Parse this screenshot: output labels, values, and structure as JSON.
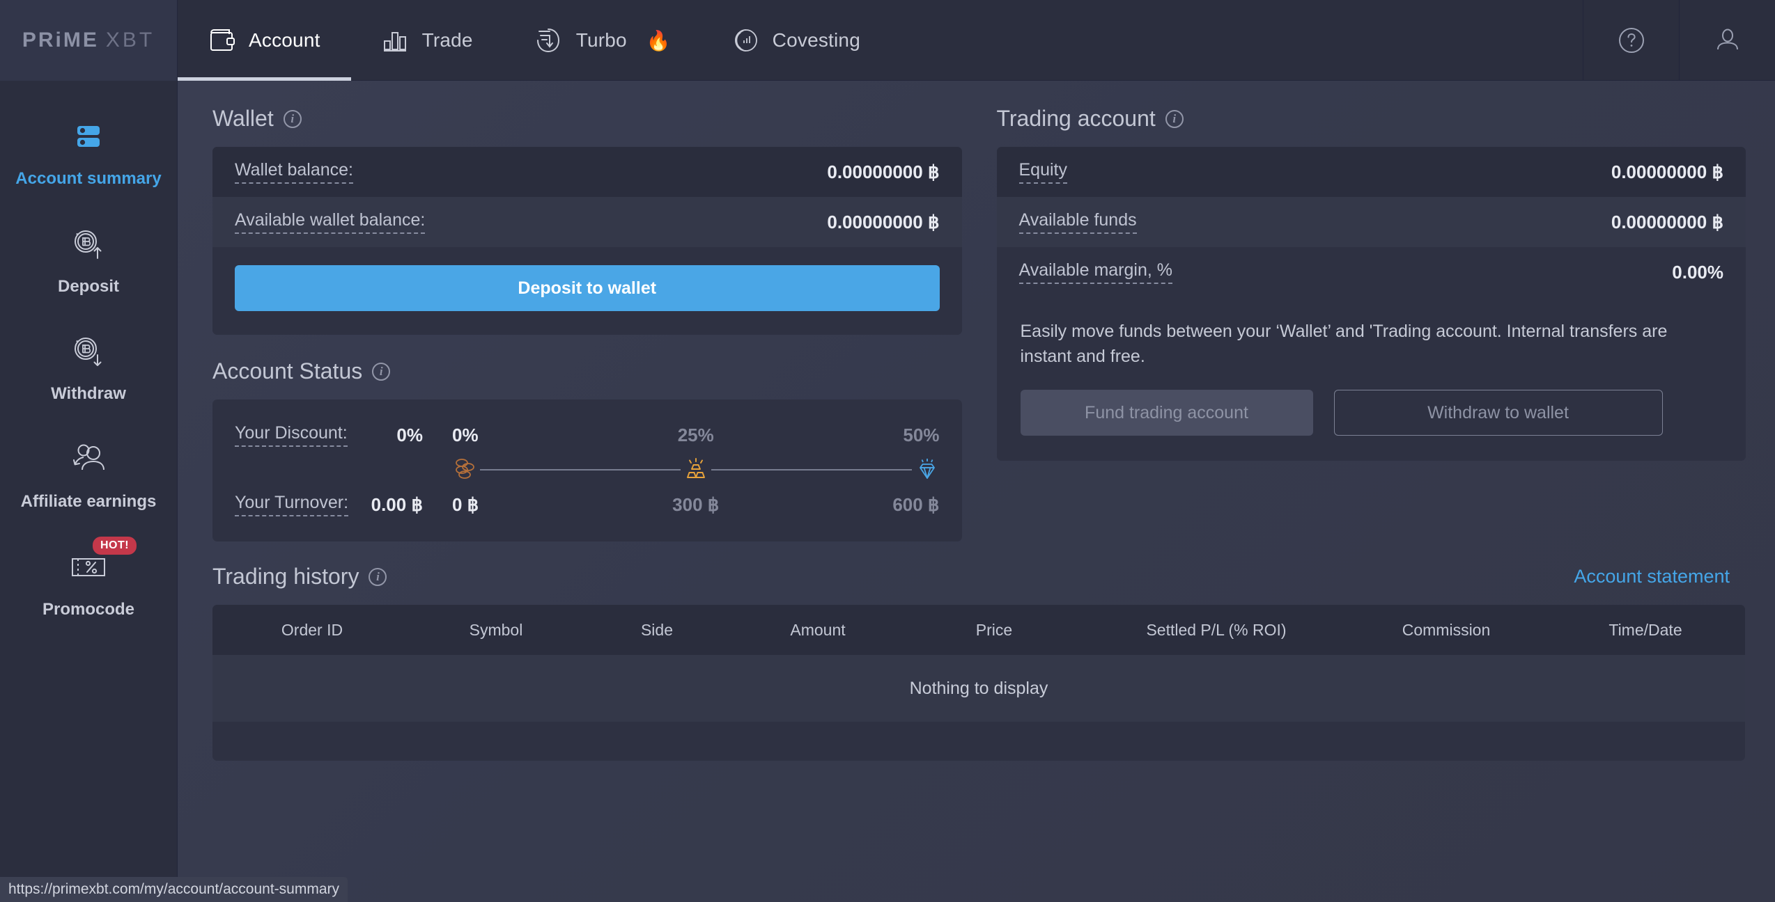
{
  "brand": {
    "prime": "PRiME",
    "xbt": "XBT"
  },
  "nav": {
    "tabs": [
      {
        "label": "Account",
        "icon": "wallet-icon",
        "active": true
      },
      {
        "label": "Trade",
        "icon": "bar-chart-icon",
        "active": false
      },
      {
        "label": "Turbo",
        "icon": "turbo-arrows-icon",
        "emoji": "🔥",
        "active": false
      },
      {
        "label": "Covesting",
        "icon": "covesting-rings-icon",
        "active": false
      }
    ],
    "help_icon": "question-mark-circle-icon",
    "profile_icon": "user-avatar-icon"
  },
  "sidebar": {
    "items": [
      {
        "label": "Account summary",
        "icon": "account-summary-icon",
        "active": true,
        "badge": ""
      },
      {
        "label": "Deposit",
        "icon": "bitcoin-deposit-icon",
        "active": false,
        "badge": ""
      },
      {
        "label": "Withdraw",
        "icon": "bitcoin-withdraw-icon",
        "active": false,
        "badge": ""
      },
      {
        "label": "Affiliate earnings",
        "icon": "affiliate-people-icon",
        "active": false,
        "badge": ""
      },
      {
        "label": "Promocode",
        "icon": "promocode-ticket-icon",
        "active": false,
        "badge": "HOT!"
      }
    ]
  },
  "wallet": {
    "title": "Wallet",
    "rows": [
      {
        "label": "Wallet balance:",
        "value": "0.00000000 ฿"
      },
      {
        "label": "Available wallet balance:",
        "value": "0.00000000 ฿"
      }
    ],
    "deposit_button": "Deposit to wallet"
  },
  "trading_account": {
    "title": "Trading account",
    "rows": [
      {
        "label": "Equity",
        "value": "0.00000000 ฿"
      },
      {
        "label": "Available funds",
        "value": "0.00000000 ฿"
      },
      {
        "label": "Available margin, %",
        "value": "0.00%"
      }
    ],
    "note": "Easily move funds between your ‘Wallet’ and 'Trading account. Internal transfers are instant and free.",
    "fund_button": "Fund trading account",
    "withdraw_button": "Withdraw to wallet"
  },
  "account_status": {
    "title": "Account Status",
    "discount_label": "Your Discount:",
    "discount_value": "0%",
    "turnover_label": "Your Turnover:",
    "turnover_value": "0.00 ฿",
    "tiers": [
      {
        "pct": "0%",
        "amount": "0 ฿",
        "icon": "bronze-coins-icon",
        "color": "#b5703a",
        "reached": true
      },
      {
        "pct": "25%",
        "amount": "300 ฿",
        "icon": "gold-bars-icon",
        "color": "#e8a33a",
        "reached": false
      },
      {
        "pct": "50%",
        "amount": "600 ฿",
        "icon": "blue-diamond-icon",
        "color": "#4aa6e6",
        "reached": false
      }
    ]
  },
  "trading_history": {
    "title": "Trading history",
    "statement_link": "Account statement",
    "columns": [
      "Order ID",
      "Symbol",
      "Side",
      "Amount",
      "Price",
      "Settled P/L (% ROI)",
      "Commission",
      "Time/Date"
    ],
    "rows": [],
    "empty_text": "Nothing to display"
  },
  "status_bar": {
    "url": "https://primexbt.com/my/account/account-summary"
  },
  "colors": {
    "accent_blue": "#4aa6e6",
    "page_bg": "#2b2e3e",
    "main_bg": "#363a4d",
    "card_bg": "#2e3142",
    "row_dark": "#2a2d3d",
    "row_light": "#343849",
    "badge_red": "#c4384a"
  }
}
